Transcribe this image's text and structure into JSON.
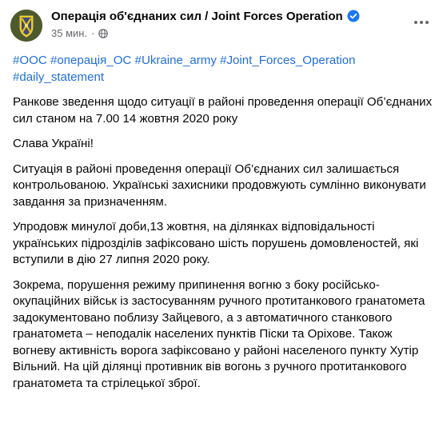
{
  "post": {
    "author": "Операція об'єднаних сил / Joint Forces Operation",
    "time": "35 мин.",
    "separator": "·",
    "icons": {
      "avatar": "jfo-emblem-avatar",
      "verified": "verified-badge-icon",
      "audience": "globe-icon",
      "more": "more-options-icon"
    },
    "colors": {
      "link": "#216fdb",
      "meta": "#65676b",
      "verified": "#1877f2"
    },
    "hashtags": [
      "#ООС",
      "#операція_ОС",
      "#Ukraine_army",
      "#Joint_Forces_Operation",
      "#daily_statement"
    ],
    "paragraphs": [
      "Ранкове зведення щодо ситуації в районі проведення операції Об’єднаних сил станом на 7.00 14 жовтня 2020 року",
      "Слава Україні!",
      "Ситуація в районі проведення операції Об’єднаних сил залишається контрольованою. Українські захисники продовжують сумлінно виконувати завдання за призначенням.",
      "Упродовж минулої доби,13 жовтня, на ділянках відповідальності українських підрозділів зафіксовано шість порушень домовленостей, які вступили в дію 27 липня 2020 року.",
      "Зокрема, порушення режиму припинення вогню з боку російсько-окупаційних військ із застосуванням ручного протитанкового гранатомета задокументовано поблизу Зайцевого, а з автоматичного станкового гранатомета – неподалік населених пунктів Піски та Оріхове. Також вогневу активність ворога зафіксовано у районі населеного пункту Хутір Вільний. На цій ділянці противник вів вогонь з ручного протитанкового гранатомета та стрілецької зброї."
    ]
  }
}
